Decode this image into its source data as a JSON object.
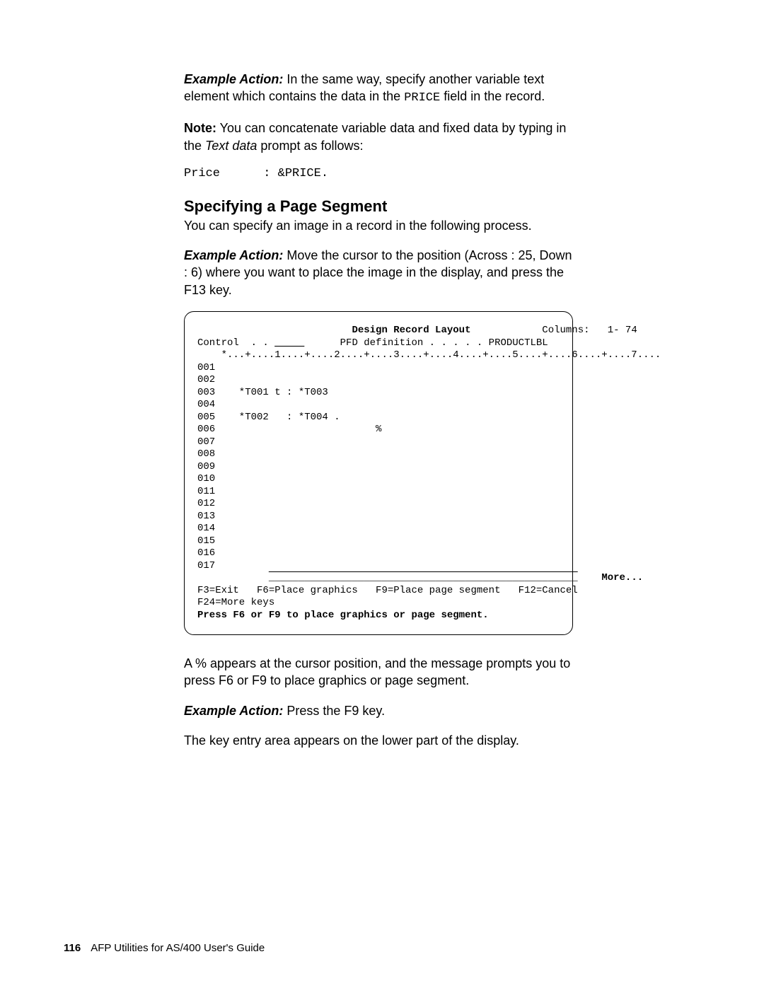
{
  "para1_label": "Example Action:",
  "para1_text1": "  In the same way, specify another variable text element which contains the data in the ",
  "para1_code": "PRICE",
  "para1_text2": " field in the record.",
  "para2_label": "Note:",
  "para2_text1": "  You can concatenate variable data and fixed data by typing in the ",
  "para2_italic": "Text data",
  "para2_text2": " prompt as follows:",
  "codeblock": "Price      : &PRICE.",
  "section_title": "Specifying a Page Segment",
  "para3": "You can specify an image in a record in the following process.",
  "para4_label": "Example Action:",
  "para4_text": "  Move the cursor to the position (Across : 25, Down : 6) where you want to place the image in the display, and press the F13 key.",
  "panel": {
    "title": "Design Record Layout",
    "columns": "Columns:   1- 74",
    "control_left": "Control  . . ",
    "control_field": "_____",
    "control_right": "      PFD definition . . . . . PRODUCTLBL",
    "ruler": "    *...+....1....+....2....+....3....+....4....+....5....+....6....+....7....",
    "lines": [
      "001",
      "002",
      "003    *T001 t : *T003",
      "004",
      "005    *T002   : *T004 .",
      "006                           %",
      "007",
      "008",
      "009",
      "010",
      "011",
      "012",
      "013",
      "014",
      "015",
      "016",
      "017"
    ],
    "more": "More...",
    "divider": "____________________________________________________",
    "fkeys1": "F3=Exit   F6=Place graphics   F9=Place page segment   F12=Cancel",
    "fkeys2": "F24=More keys",
    "bold_msg": "Press F6 or F9 to place graphics or page segment."
  },
  "para5": "A % appears at the cursor position, and the message prompts you to press F6 or F9 to place graphics or page segment.",
  "para6_label": "Example Action:",
  "para6_text": "  Press the F9 key.",
  "para7": "The key entry area appears on the lower part of the display.",
  "footer_page": "116",
  "footer_text": "AFP Utilities for AS/400 User's Guide"
}
